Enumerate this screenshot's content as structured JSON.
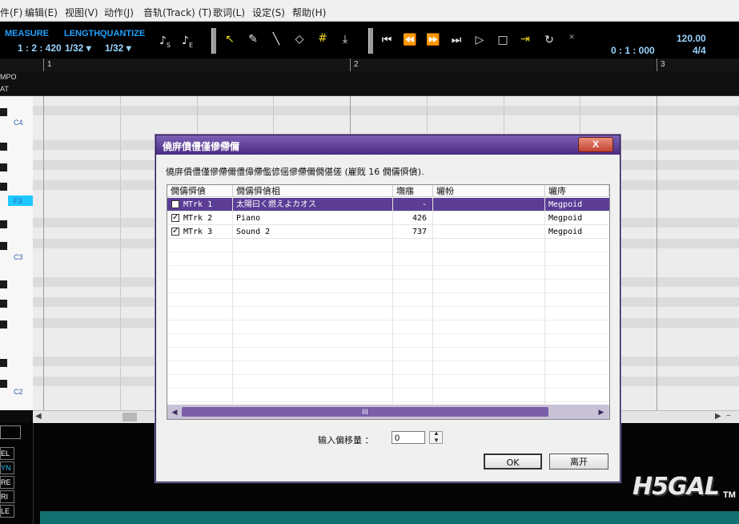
{
  "menu": {
    "items": [
      "件(F)",
      "编辑(E)",
      "视图(V)",
      "动作(J)",
      "音轨(Track) (T)",
      "歌词(L)",
      "设定(S)",
      "帮助(H)"
    ]
  },
  "toolbar": {
    "measure_label": "MEASURE",
    "measure_value": "1 : 2 : 420",
    "length_label": "LENGTH",
    "length_value": "1/32 ▾",
    "quantize_label": "QUANTIZE",
    "quantize_value": "1/32 ▾",
    "note_s": "S",
    "note_e": "E",
    "time_value": "0 : 1 : 000",
    "tempo_value": "120.00",
    "beat_value": "4/4"
  },
  "ruler": {
    "measures": [
      "1",
      "2",
      "3"
    ],
    "tempo_label": "MPO",
    "beat_label": "AT"
  },
  "piano": {
    "notes": [
      "C4",
      "F3",
      "C3",
      "C2"
    ]
  },
  "bottom": {
    "labels": [
      "EL",
      "YN",
      "RE",
      "RI",
      "LE"
    ]
  },
  "dialog": {
    "title": "僥庰僨僼僅傪僀儞",
    "description": "僥庰僨僼僅傪僀儞僼傽僀儖偐傜傪僀儞僩偡傞 (嵟戝 16 僩儔僢僋).",
    "columns": [
      "僩儔僢僋",
      "僩儔僢僋柤",
      "墲瘬",
      "壧帉",
      "壧庤"
    ],
    "rows": [
      {
        "checked": false,
        "track": "MTrk 1",
        "name": "太陽曰く燃えよカオス",
        "count": "-",
        "lyrics": "",
        "singer": "Megpoid",
        "selected": true
      },
      {
        "checked": true,
        "track": "MTrk 2",
        "name": "Piano",
        "count": "426",
        "lyrics": "",
        "singer": "Megpoid",
        "selected": false
      },
      {
        "checked": true,
        "track": "MTrk 3",
        "name": "Sound 2",
        "count": "737",
        "lyrics": "",
        "singer": "Megpoid",
        "selected": false
      }
    ],
    "scroll_thumb": "III",
    "offset_label": "输入偏移量 ：",
    "offset_value": "0",
    "ok_label": "OK",
    "cancel_label": "离开",
    "close_label": "X"
  },
  "watermark": "H5GAL",
  "trademark": "TM",
  "colors": {
    "accent": "#1ea0ff",
    "selection": "#5c3d96",
    "title_bar": "#5a3c8e",
    "piano_highlight": "#1ec8ff"
  }
}
